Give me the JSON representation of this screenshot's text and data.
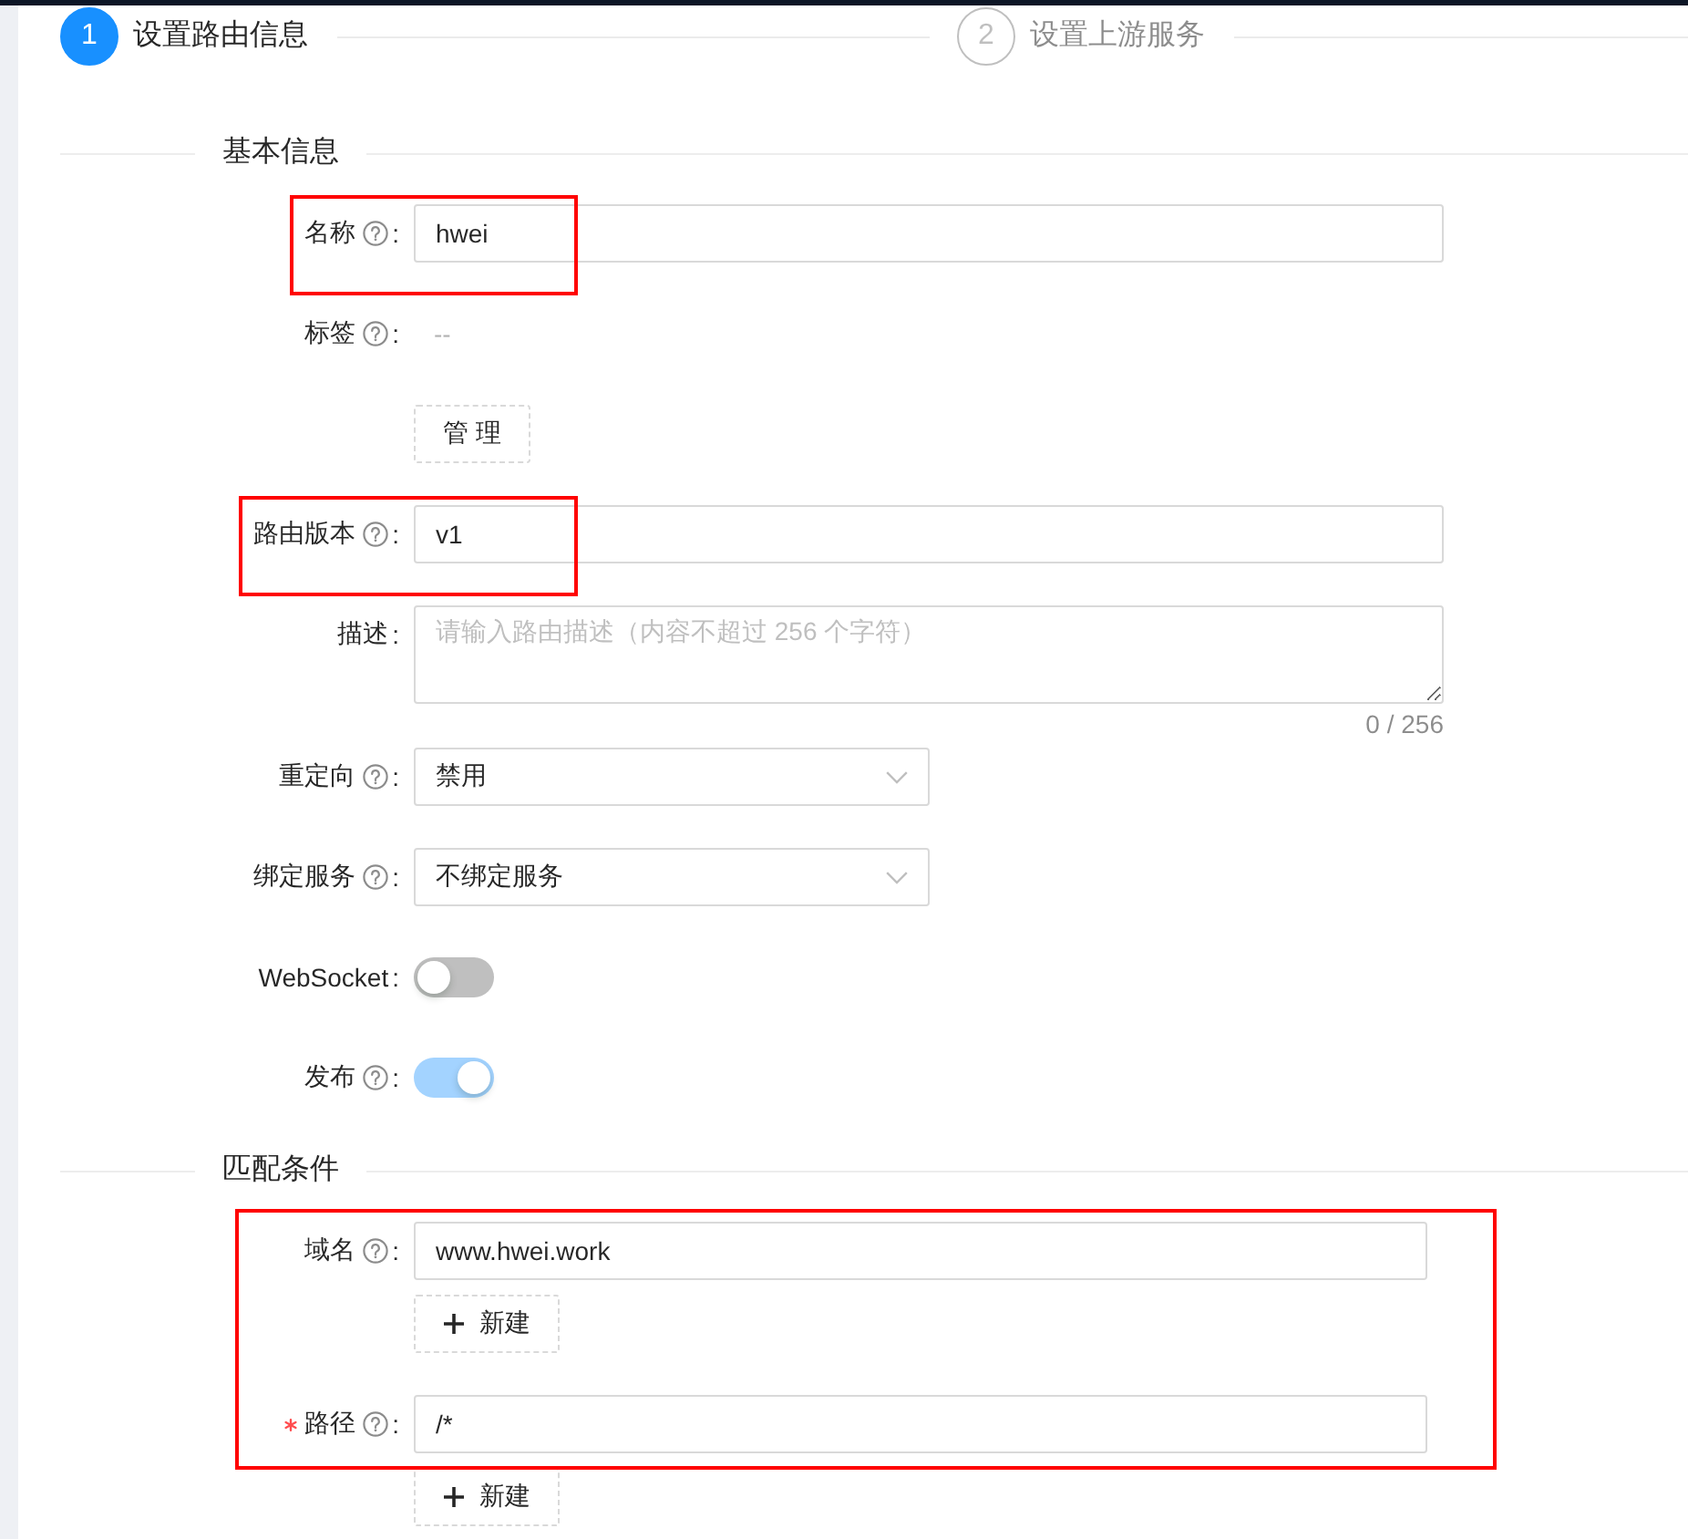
{
  "steps": [
    {
      "number": "1",
      "title": "设置路由信息",
      "selected": true
    },
    {
      "number": "2",
      "title": "设置上游服务",
      "selected": false
    }
  ],
  "sections": [
    {
      "title": "基本信息",
      "highlighted": false,
      "fields": [
        {
          "kind": "input",
          "label": "名称",
          "colon": ":",
          "help": true,
          "required": false,
          "highlighted": true,
          "value": "hwei"
        },
        {
          "kind": "tags",
          "label": "标签",
          "colon": ":",
          "help": true,
          "required": false,
          "highlighted": false,
          "value": "--",
          "button": "管 理"
        },
        {
          "kind": "input",
          "label": "路由版本",
          "colon": ":",
          "help": true,
          "required": false,
          "highlighted": true,
          "value": "v1"
        },
        {
          "kind": "textarea",
          "label": "描述",
          "colon": ":",
          "help": false,
          "required": false,
          "highlighted": false,
          "placeholder": "请输入路由描述（内容不超过 256 个字符）",
          "counter": "0 / 256"
        },
        {
          "kind": "select",
          "label": "重定向",
          "colon": ":",
          "help": true,
          "required": false,
          "highlighted": false,
          "value": "禁用"
        },
        {
          "kind": "select",
          "label": "绑定服务",
          "colon": ":",
          "help": true,
          "required": false,
          "highlighted": false,
          "value": "不绑定服务"
        },
        {
          "kind": "switch",
          "label": "WebSocket",
          "colon": ":",
          "help": false,
          "required": false,
          "highlighted": false,
          "on": false
        },
        {
          "kind": "switch",
          "label": "发布",
          "colon": ":",
          "help": true,
          "required": false,
          "highlighted": false,
          "on": true
        }
      ]
    },
    {
      "title": "匹配条件",
      "highlighted": true,
      "fields": [
        {
          "kind": "list",
          "label": "域名",
          "colon": ":",
          "help": true,
          "required": false,
          "highlighted": false,
          "value": "www.hwei.work",
          "button": "新建"
        },
        {
          "kind": "list",
          "label": "路径",
          "colon": ":",
          "help": true,
          "required": true,
          "highlighted": false,
          "value": "/*",
          "button": "新建"
        }
      ]
    }
  ]
}
